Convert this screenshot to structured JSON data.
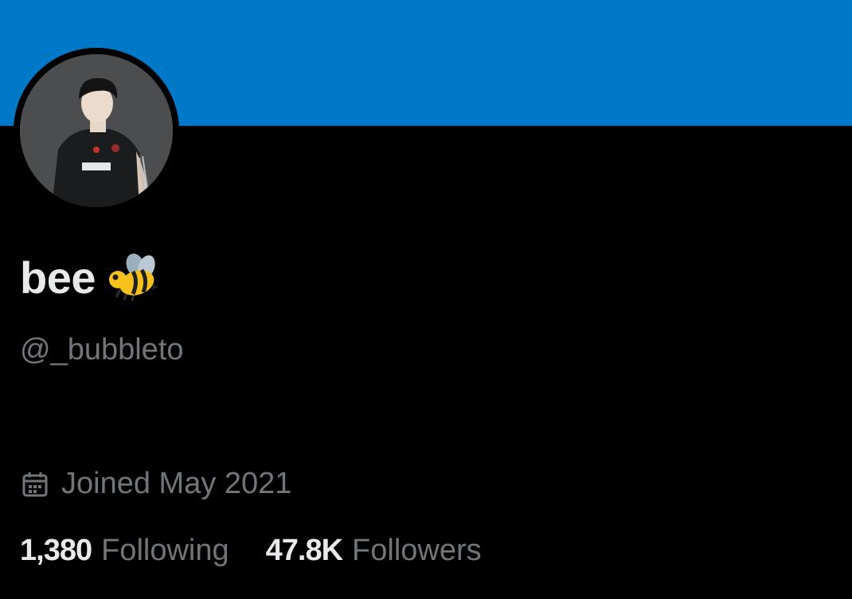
{
  "colors": {
    "banner": "#0078c8",
    "background": "#000000",
    "primary_text": "#e7e9ea",
    "secondary_text": "#71767b"
  },
  "profile": {
    "display_name": "bee",
    "name_emoji": "bee-icon",
    "handle": "@_bubbleto",
    "joined": "Joined May 2021",
    "joined_icon": "calendar-icon",
    "avatar": "avatar-photo"
  },
  "stats": {
    "following_count": "1,380",
    "following_label": "Following",
    "followers_count": "47.8K",
    "followers_label": "Followers"
  }
}
